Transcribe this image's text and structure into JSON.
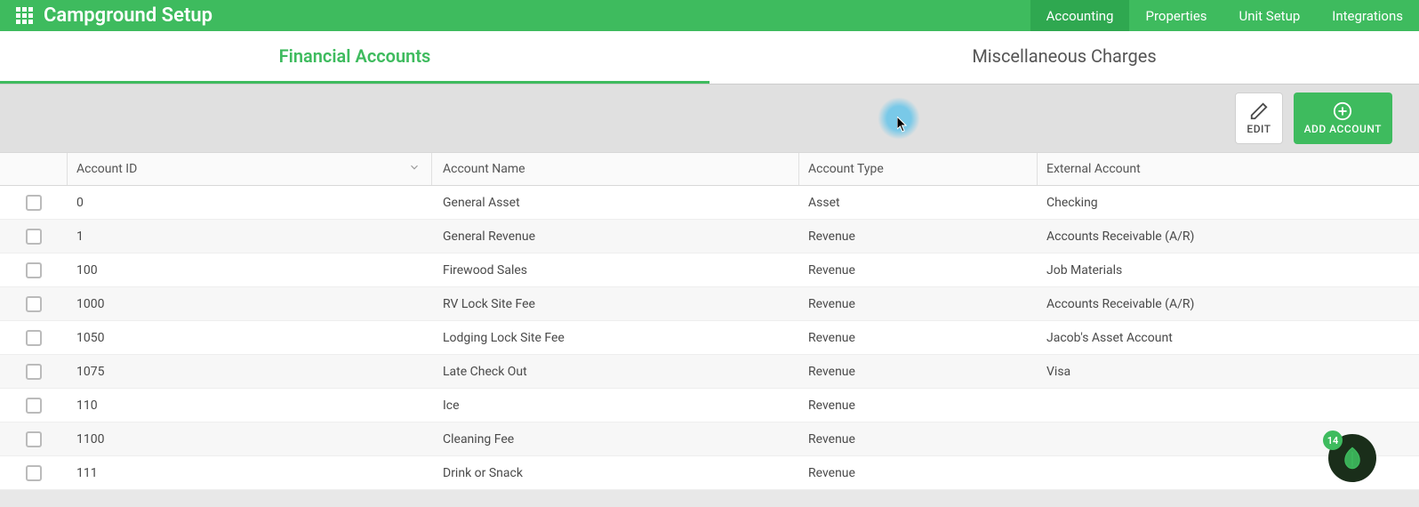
{
  "header": {
    "title": "Campground Setup",
    "nav": [
      {
        "label": "Accounting",
        "active": true
      },
      {
        "label": "Properties",
        "active": false
      },
      {
        "label": "Unit Setup",
        "active": false
      },
      {
        "label": "Integrations",
        "active": false
      }
    ]
  },
  "subTabs": [
    {
      "label": "Financial Accounts",
      "active": true
    },
    {
      "label": "Miscellaneous Charges",
      "active": false
    }
  ],
  "toolbar": {
    "edit_label": "EDIT",
    "add_label": "ADD ACCOUNT"
  },
  "table": {
    "columns": {
      "id": "Account ID",
      "name": "Account Name",
      "type": "Account Type",
      "ext": "External Account"
    },
    "rows": [
      {
        "id": "0",
        "name": "General Asset",
        "type": "Asset",
        "ext": "Checking"
      },
      {
        "id": "1",
        "name": "General Revenue",
        "type": "Revenue",
        "ext": "Accounts Receivable (A/R)"
      },
      {
        "id": "100",
        "name": "Firewood Sales",
        "type": "Revenue",
        "ext": "Job Materials"
      },
      {
        "id": "1000",
        "name": "RV Lock Site Fee",
        "type": "Revenue",
        "ext": "Accounts Receivable (A/R)"
      },
      {
        "id": "1050",
        "name": "Lodging Lock Site Fee",
        "type": "Revenue",
        "ext": "Jacob's Asset Account"
      },
      {
        "id": "1075",
        "name": "Late Check Out",
        "type": "Revenue",
        "ext": "Visa"
      },
      {
        "id": "110",
        "name": "Ice",
        "type": "Revenue",
        "ext": ""
      },
      {
        "id": "1100",
        "name": "Cleaning Fee",
        "type": "Revenue",
        "ext": ""
      },
      {
        "id": "111",
        "name": "Drink or Snack",
        "type": "Revenue",
        "ext": ""
      }
    ]
  },
  "fab": {
    "badge": "14"
  }
}
